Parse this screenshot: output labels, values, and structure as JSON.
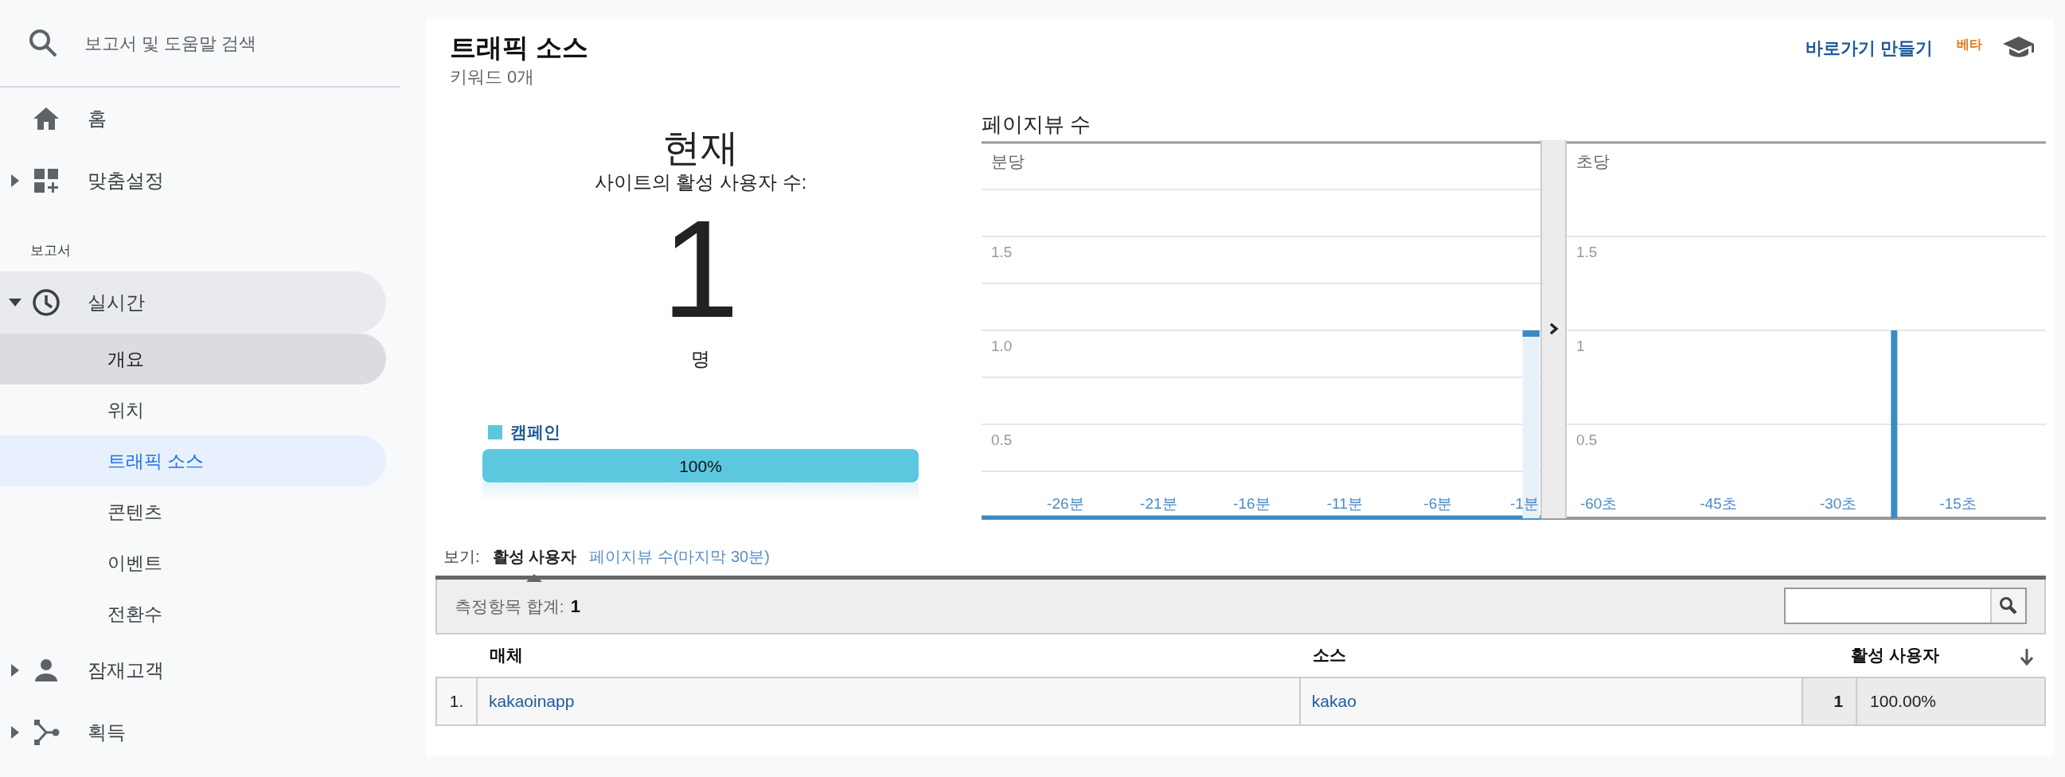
{
  "sidebar": {
    "search": {
      "placeholder": "보고서 및 도움말 검색"
    },
    "items": [
      {
        "kind": "link",
        "label": "홈"
      },
      {
        "kind": "link",
        "label": "맞춤설정",
        "expanded": false
      },
      {
        "kind": "heading",
        "label": "보고서"
      },
      {
        "kind": "link",
        "label": "실시간",
        "expanded": true,
        "children": [
          {
            "label": "개요",
            "selected": false,
            "hovered": true
          },
          {
            "label": "위치",
            "selected": false,
            "hovered": false
          },
          {
            "label": "트래픽 소스",
            "selected": true,
            "hovered": false
          },
          {
            "label": "콘텐츠",
            "selected": false,
            "hovered": false
          },
          {
            "label": "이벤트",
            "selected": false,
            "hovered": false
          },
          {
            "label": "전환수",
            "selected": false,
            "hovered": false
          }
        ]
      },
      {
        "kind": "link",
        "label": "잠재고객",
        "expanded": false
      },
      {
        "kind": "link",
        "label": "획득",
        "expanded": false
      }
    ]
  },
  "header": {
    "title": "트래픽 소스",
    "subtitle": "키워드 0개",
    "shortcut": "바로가기 만들기",
    "badge": "베타"
  },
  "summary": {
    "heading": "현재",
    "caption": "사이트의 활성 사용자 수:",
    "value": "1",
    "unit": "명",
    "legend": [
      {
        "label": "캠페인",
        "color": "#5bc8e0"
      }
    ],
    "bar": {
      "label": "100%",
      "level": 1,
      "color": "#5bc8e0"
    }
  },
  "pageviews": {
    "title": "페이지뷰 수",
    "panels": [
      {
        "label": "분당",
        "chart_data": {
          "type": "bar",
          "x": [
            -30,
            -29,
            -28,
            -27,
            -26,
            -25,
            -24,
            -23,
            -22,
            -21,
            -20,
            -19,
            -18,
            -17,
            -16,
            -15,
            -14,
            -13,
            -12,
            -11,
            -10,
            -9,
            -8,
            -7,
            -6,
            -5,
            -4,
            -3,
            -2,
            -1
          ],
          "values": [
            0,
            0,
            0,
            0,
            0,
            0,
            0,
            0,
            0,
            0,
            0,
            0,
            0,
            0,
            0,
            0,
            0,
            0,
            0,
            0,
            0,
            0,
            0,
            0,
            0,
            0,
            0,
            0,
            0,
            1
          ],
          "xlim": [
            -30.5,
            -0.5
          ],
          "ylim": [
            0,
            2
          ],
          "grid": true,
          "yticks": [
            0.5,
            {
              "value": 1,
              "label": "1.0"
            },
            1.5
          ],
          "xticks": [
            {
              "value": -26,
              "label": "-26분"
            },
            {
              "value": -21,
              "label": "-21분"
            },
            {
              "value": -16,
              "label": "-16분"
            },
            {
              "value": -11,
              "label": "-11분"
            },
            {
              "value": -6,
              "label": "-6분"
            },
            {
              "value": -1,
              "label": "-1분"
            }
          ]
        }
      },
      {
        "label": "초당",
        "chart_data": {
          "type": "bar",
          "x": [
            -63,
            -62,
            -61,
            -60,
            -59,
            -58,
            -57,
            -56,
            -55,
            -54,
            -53,
            -52,
            -51,
            -50,
            -49,
            -48,
            -47,
            -46,
            -45,
            -44,
            -43,
            -42,
            -41,
            -40,
            -39,
            -38,
            -37,
            -36,
            -35,
            -34,
            -33,
            -32,
            -31,
            -30,
            -29,
            -28,
            -27,
            -26,
            -25,
            -24,
            -23,
            -22,
            -21,
            -20,
            -19,
            -18,
            -17,
            -16,
            -15,
            -14,
            -13,
            -12,
            -11,
            -10,
            -9,
            -8,
            -7,
            -6,
            -5,
            -4
          ],
          "values": [
            0,
            0,
            0,
            0,
            0,
            0,
            0,
            0,
            0,
            0,
            0,
            0,
            0,
            0,
            0,
            0,
            0,
            0,
            0,
            0,
            0,
            0,
            0,
            0,
            0,
            0,
            0,
            0,
            0,
            0,
            0,
            0,
            0,
            0,
            0,
            0,
            0,
            0,
            0,
            0,
            1,
            0,
            0,
            0,
            0,
            0,
            0,
            0,
            0,
            0,
            0,
            0,
            0,
            0,
            0,
            0,
            0,
            0,
            0,
            0
          ],
          "xlim": [
            -64,
            -4
          ],
          "ylim": [
            0,
            2
          ],
          "grid": true,
          "yticks": [
            0.5,
            1,
            1.5
          ],
          "xticks": [
            {
              "value": -60,
              "label": "-60초"
            },
            {
              "value": -45,
              "label": "-45초"
            },
            {
              "value": -30,
              "label": "-30초"
            },
            {
              "value": -15,
              "label": "-15초"
            }
          ]
        }
      }
    ]
  },
  "view": {
    "label": "보기:",
    "options": [
      {
        "label": "활성 사용자",
        "selected": true
      },
      {
        "label": "페이지뷰 수(마지막 30분)",
        "selected": false
      }
    ]
  },
  "table": {
    "total_label": "측정항목 합계:",
    "total_value": "1",
    "columns": [
      {
        "label": "매체"
      },
      {
        "label": "소스"
      },
      {
        "label": "활성 사용자",
        "sorted": true
      }
    ],
    "rows": [
      {
        "index": "1.",
        "medium": "kakaoinapp",
        "source": "kakao",
        "value": "1",
        "percent": "100.00%"
      }
    ]
  }
}
